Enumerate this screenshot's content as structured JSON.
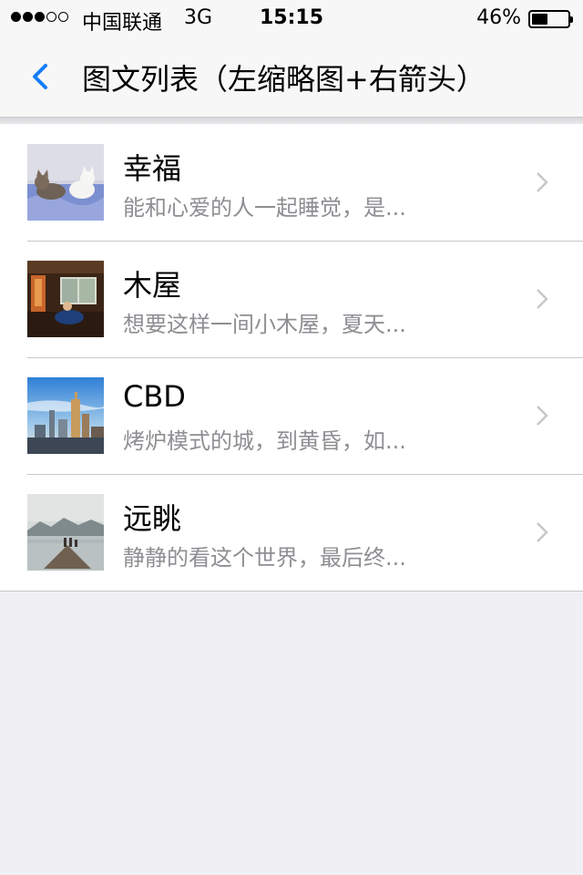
{
  "status_bar": {
    "carrier": "中国联通",
    "network": "3G",
    "time": "15:15",
    "battery_percent": "46%",
    "battery_level": 0.46,
    "signal_bars": [
      true,
      true,
      true,
      false,
      false
    ]
  },
  "nav": {
    "back_icon": "chevron-left-icon",
    "title": "图文列表（左缩略图+右箭头）",
    "accent_color": "#147efb"
  },
  "list": {
    "items": [
      {
        "title": "幸福",
        "subtitle": "能和心爱的人一起睡觉，是...",
        "thumbnail": "cats-sleeping"
      },
      {
        "title": "木屋",
        "subtitle": "想要这样一间小木屋，夏天...",
        "thumbnail": "wooden-cabin-interior"
      },
      {
        "title": "CBD",
        "subtitle": "烤炉模式的城，到黄昏，如...",
        "thumbnail": "city-skyline"
      },
      {
        "title": "远眺",
        "subtitle": "静静的看这个世界，最后终...",
        "thumbnail": "lake-pier-mountains"
      }
    ]
  }
}
